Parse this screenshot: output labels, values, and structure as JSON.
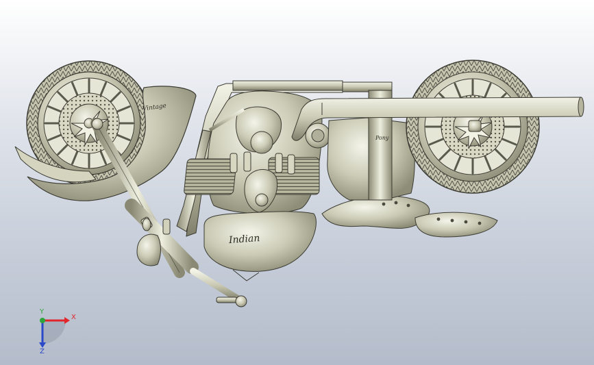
{
  "viewport": {
    "background_top": "#ffffff",
    "background_bottom": "#b4bccb"
  },
  "model": {
    "tank_brand": "Indian",
    "fender_text": "Vintage",
    "frame_text": "Pony"
  },
  "triad": {
    "x_label": "X",
    "y_label": "Y",
    "z_label": "Z",
    "x_color": "#e3262c",
    "y_color": "#2ea43a",
    "z_color": "#2a48c8"
  }
}
